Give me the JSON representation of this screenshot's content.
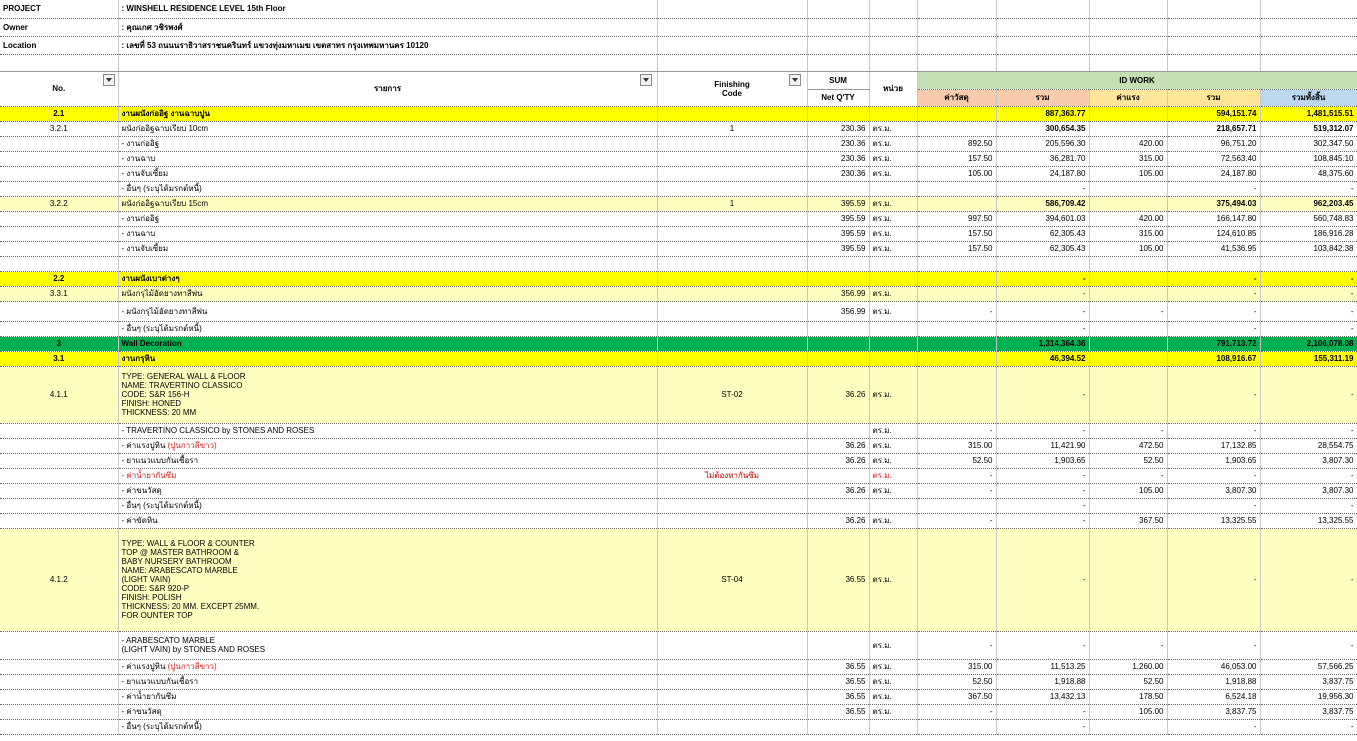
{
  "project": {
    "project_label": "PROJECT",
    "project_value": ": WINSHELL RESIDENCE LEVEL 15th Floor",
    "owner_label": "Owner",
    "owner_value": ": คุณเกศ วชิรพงศ์",
    "location_label": "Location",
    "location_value": ": เลขที่ 53 ถนนนราธิวาสราชนครินทร์ แขวงทุ่งมหาเมฆ เขตสาทร กรุงเทพมหานคร 10120"
  },
  "header": {
    "no": "No.",
    "item": "รายการ",
    "finishing_code_1": "Finishing",
    "finishing_code_2": "Code",
    "sum": "SUM",
    "net_qty": "Net Q'TY",
    "unit": "หน่วย",
    "id_work": "ID WORK",
    "material": "ค่าวัสดุ",
    "total1": "รวม",
    "labor": "ค่าแรง",
    "total2": "รวม",
    "grand_total": "รวมทั้งสิ้น"
  },
  "rows": [
    {
      "style": "yellow",
      "no": "2.1",
      "item": "งานผนังก่ออิฐ งานฉาบปูน",
      "code": "",
      "qty": "",
      "unit": "",
      "mat": "",
      "tot1": "887,363.77",
      "lab": "",
      "tot2": "594,151.74",
      "grand": "1,481,515.51",
      "bold": true,
      "h": 15
    },
    {
      "style": "white",
      "no": "3.2.1",
      "item": "ผนังก่ออิฐฉาบเรียบ 10cm",
      "code": "1",
      "qty": "230.36",
      "unit": "ตร.ม.",
      "mat": "",
      "tot1": "300,654.35",
      "lab": "",
      "tot2": "218,657.71",
      "grand": "519,312.07",
      "boldnum": true,
      "h": 15
    },
    {
      "style": "white",
      "no": "",
      "item": "- งานก่ออิฐ",
      "code": "",
      "qty": "230.36",
      "unit": "ตร.ม.",
      "mat": "892.50",
      "tot1": "205,596.30",
      "lab": "420.00",
      "tot2": "96,751.20",
      "grand": "302,347.50",
      "h": 15
    },
    {
      "style": "white",
      "no": "",
      "item": "- งานฉาบ",
      "code": "",
      "qty": "230.36",
      "unit": "ตร.ม.",
      "mat": "157.50",
      "tot1": "36,281.70",
      "lab": "315.00",
      "tot2": "72,563.40",
      "grand": "108,845.10",
      "h": 15
    },
    {
      "style": "white",
      "no": "",
      "item": "- งานจับเซี้ยม",
      "code": "",
      "qty": "230.36",
      "unit": "ตร.ม.",
      "mat": "105.00",
      "tot1": "24,187.80",
      "lab": "105.00",
      "tot2": "24,187.80",
      "grand": "48,375.60",
      "h": 15
    },
    {
      "style": "white",
      "no": "",
      "item": "- อื่นๆ (ระบุได้มรกต์หนี้)",
      "code": "",
      "qty": "",
      "unit": "",
      "mat": "",
      "tot1": "-",
      "lab": "",
      "tot2": "-",
      "grand": "-",
      "h": 15
    },
    {
      "style": "ltyel",
      "no": "3.2.2",
      "item": "ผนังก่ออิฐฉาบเรียบ 15cm",
      "code": "1",
      "qty": "395.59",
      "unit": "ตร.ม.",
      "mat": "",
      "tot1": "586,709.42",
      "lab": "",
      "tot2": "375,494.03",
      "grand": "962,203.45",
      "boldnum": true,
      "h": 15
    },
    {
      "style": "white",
      "no": "",
      "item": "- งานก่ออิฐ",
      "code": "",
      "qty": "395.59",
      "unit": "ตร.ม.",
      "mat": "997.50",
      "tot1": "394,601.03",
      "lab": "420.00",
      "tot2": "166,147.80",
      "grand": "560,748.83",
      "h": 15
    },
    {
      "style": "white",
      "no": "",
      "item": "- งานฉาบ",
      "code": "",
      "qty": "395.59",
      "unit": "ตร.ม.",
      "mat": "157.50",
      "tot1": "62,305.43",
      "lab": "315.00",
      "tot2": "124,610.85",
      "grand": "186,916.28",
      "h": 15
    },
    {
      "style": "white",
      "no": "",
      "item": "- งานจับเซี้ยม",
      "code": "",
      "qty": "395.59",
      "unit": "ตร.ม.",
      "mat": "157.50",
      "tot1": "62,305.43",
      "lab": "105.00",
      "tot2": "41,536.95",
      "grand": "103,842.38",
      "h": 15
    },
    {
      "style": "white",
      "no": "",
      "item": "",
      "code": "",
      "qty": "",
      "unit": "",
      "mat": "",
      "tot1": "",
      "lab": "",
      "tot2": "",
      "grand": "",
      "h": 15
    },
    {
      "style": "yellow",
      "no": "2.2",
      "item": "งานผนังเบาต่างๆ",
      "code": "",
      "qty": "",
      "unit": "",
      "mat": "",
      "tot1": "-",
      "lab": "",
      "tot2": "-",
      "grand": "-",
      "bold": true,
      "h": 15
    },
    {
      "style": "ltyel",
      "no": "3.3.1",
      "item": "ผนังกรุไม้อัดยางทาสีพ่น",
      "code": "",
      "qty": "356.99",
      "unit": "ตร.ม.",
      "mat": "",
      "tot1": "-",
      "lab": "",
      "tot2": "-",
      "grand": "-",
      "h": 15
    },
    {
      "style": "white",
      "no": "",
      "item": "- ผนังกรุไม้อัดยางทาสีพ่น",
      "code": "",
      "qty": "356.99",
      "unit": "ตร.ม.",
      "mat": "-",
      "tot1": "-",
      "lab": "-",
      "tot2": "-",
      "grand": "-",
      "h": 20
    },
    {
      "style": "white",
      "no": "",
      "item": "- อื่นๆ (ระบุได้มรกต์หนี้)",
      "code": "",
      "qty": "",
      "unit": "",
      "mat": "",
      "tot1": "-",
      "lab": "",
      "tot2": "-",
      "grand": "-",
      "h": 15
    },
    {
      "style": "green",
      "no": "3",
      "item": "Wall Decoration",
      "code": "",
      "qty": "",
      "unit": "",
      "mat": "",
      "tot1": "1,314,364.36",
      "lab": "",
      "tot2": "791,713.72",
      "grand": "2,106,078.08",
      "bold": true,
      "h": 15
    },
    {
      "style": "yellow",
      "no": "3.1",
      "item": "งานกรุหิน",
      "code": "",
      "qty": "",
      "unit": "",
      "mat": "",
      "tot1": "46,394.52",
      "lab": "",
      "tot2": "108,916.67",
      "grand": "155,311.19",
      "bold": true,
      "h": 15
    },
    {
      "style": "ltyel",
      "no": "4.1.1",
      "item": "TYPE: GENERAL WALL & FLOOR\nNAME: TRAVERTINO CLASSICO\nCODE: S&R 156-H\nFINISH: HONED\nTHICKNESS: 20 MM",
      "code": "ST-02",
      "qty": "36.26",
      "unit": "ตร.ม.",
      "mat": "",
      "tot1": "-",
      "lab": "",
      "tot2": "-",
      "grand": "-",
      "multi": true,
      "h": 57
    },
    {
      "style": "white",
      "no": "",
      "item": "- TRAVERTINO CLASSICO by STONES AND ROSES",
      "code": "",
      "qty": "",
      "unit": "ตร.ม.",
      "mat": "-",
      "tot1": "-",
      "lab": "-",
      "tot2": "-",
      "grand": "-",
      "h": 15
    },
    {
      "style": "white",
      "no": "",
      "item": "- ค่าแรงปูหิน",
      "itemred": " (ปูนกาวสีขาว)",
      "code": "",
      "qty": "36.26",
      "unit": "ตร.ม.",
      "mat": "315.00",
      "tot1": "11,421.90",
      "lab": "472.50",
      "tot2": "17,132.85",
      "grand": "28,554.75",
      "h": 15
    },
    {
      "style": "white",
      "no": "",
      "item": "- ยาแนวแบบกันเชื้อรา",
      "code": "",
      "qty": "36.26",
      "unit": "ตร.ม.",
      "mat": "52.50",
      "tot1": "1,903.65",
      "lab": "52.50",
      "tot2": "1,903.65",
      "grand": "3,807.30",
      "h": 15
    },
    {
      "style": "white",
      "no": "",
      "item": "",
      "itemredonly": "- ค่าน้ำยากันซึม",
      "code": "",
      "codered": "ไม่ต้องทากันซึม",
      "qty": "",
      "unit": "ตร.ม.",
      "unitred": true,
      "mat": "-",
      "tot1": "-",
      "lab": "-",
      "tot2": "-",
      "grand": "-",
      "h": 15
    },
    {
      "style": "white",
      "no": "",
      "item": "- ค่าขนวัสดุ",
      "code": "",
      "qty": "36.26",
      "unit": "ตร.ม.",
      "mat": "-",
      "tot1": "-",
      "lab": "105.00",
      "tot2": "3,807.30",
      "grand": "3,807.30",
      "h": 15
    },
    {
      "style": "white",
      "no": "",
      "item": "- อื่นๆ (ระบุได้มรกต์หนี้)",
      "code": "",
      "qty": "",
      "unit": "",
      "mat": "",
      "tot1": "-",
      "lab": "",
      "tot2": "-",
      "grand": "-",
      "h": 15
    },
    {
      "style": "white",
      "no": "",
      "item": "- ค่าขัดหิน",
      "code": "",
      "qty": "36.26",
      "unit": "ตร.ม.",
      "mat": "-",
      "tot1": "-",
      "lab": "367.50",
      "tot2": "13,325.55",
      "grand": "13,325.55",
      "h": 15
    },
    {
      "style": "ltyel",
      "no": "4.1.2",
      "item": "TYPE: WALL & FLOOR & COUNTER\nTOP @ MASTER BATHROOM &\nBABY NURSERY BATHROOM\nNAME: ARABESCATO MARBLE\n(LIGHT VAIN)\nCODE: S&R 920-P\nFINISH: POLISH\nTHICKNESS: 20 MM. EXCEPT 25MM.\nFOR OUNTER TOP",
      "code": "ST-04",
      "qty": "36.55",
      "unit": "ตร.ม.",
      "mat": "",
      "tot1": "-",
      "lab": "",
      "tot2": "-",
      "grand": "-",
      "multi": true,
      "h": 103
    },
    {
      "style": "white",
      "no": "",
      "item": "- ARABESCATO MARBLE\n(LIGHT VAIN) by STONES AND ROSES",
      "code": "",
      "qty": "",
      "unit": "ตร.ม.",
      "mat": "-",
      "tot1": "-",
      "lab": "-",
      "tot2": "-",
      "grand": "-",
      "multi": true,
      "h": 28
    },
    {
      "style": "white",
      "no": "",
      "item": "- ค่าแรงปูหิน",
      "itemred": " (ปูนกาวสีขาว)",
      "code": "",
      "qty": "36.55",
      "unit": "ตร.ม.",
      "mat": "315.00",
      "tot1": "11,513.25",
      "lab": "1,260.00",
      "tot2": "46,053.00",
      "grand": "57,566.25",
      "h": 15
    },
    {
      "style": "white",
      "no": "",
      "item": "- ยาแนวแบบกันเชื้อรา",
      "code": "",
      "qty": "36.55",
      "unit": "ตร.ม.",
      "mat": "52.50",
      "tot1": "1,918.88",
      "lab": "52.50",
      "tot2": "1,918.88",
      "grand": "3,837.75",
      "h": 15
    },
    {
      "style": "white",
      "no": "",
      "item": "- ค่าน้ำยากันซึม",
      "code": "",
      "qty": "36.55",
      "unit": "ตร.ม.",
      "mat": "367.50",
      "tot1": "13,432.13",
      "lab": "178.50",
      "tot2": "6,524.18",
      "grand": "19,956.30",
      "h": 15
    },
    {
      "style": "white",
      "no": "",
      "item": "- ค่าขนวัสดุ",
      "code": "",
      "qty": "36.55",
      "unit": "ตร.ม.",
      "mat": "-",
      "tot1": "-",
      "lab": "105.00",
      "tot2": "3,837.75",
      "grand": "3,837.75",
      "h": 15
    },
    {
      "style": "white",
      "no": "",
      "item": "- อื่นๆ (ระบุได้มรกต์หนี้)",
      "code": "",
      "qty": "",
      "unit": "",
      "mat": "",
      "tot1": "-",
      "lab": "",
      "tot2": "-",
      "grand": "-",
      "h": 15
    }
  ],
  "colors": {
    "yellow": "#ffff00",
    "light_yellow": "#ffffc0",
    "green": "#00b050",
    "header_green": "#c4e0b4",
    "header_pink": "#f8cbad",
    "header_yellow": "#ffe699",
    "header_blue": "#bdd7ee",
    "red_text": "#d62020"
  }
}
